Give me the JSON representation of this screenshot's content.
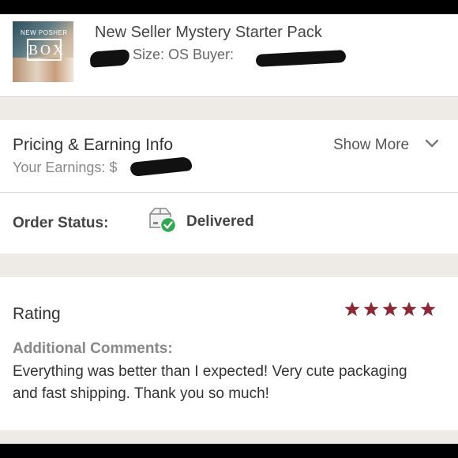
{
  "product": {
    "title": "New Seller Mystery Starter Pack",
    "meta": "Size: OS  Buyer:",
    "thumbnail_text_top": "NEW POSHER",
    "thumbnail_text_main": "BOX"
  },
  "pricing": {
    "title": "Pricing & Earning Info",
    "earnings_label": "Your Earnings: $",
    "show_more": "Show More"
  },
  "order_status": {
    "label": "Order Status:",
    "value": "Delivered"
  },
  "rating": {
    "title": "Rating",
    "stars": 5,
    "max_stars": 5,
    "star_color": "#8b2a35",
    "comments_label": "Additional Comments:",
    "comments_text": "Everything was better than I expected! Very cute packaging and fast shipping. Thank you so much!"
  },
  "colors": {
    "delivered_check": "#2fa84f",
    "section_band": "#eeebe6"
  }
}
